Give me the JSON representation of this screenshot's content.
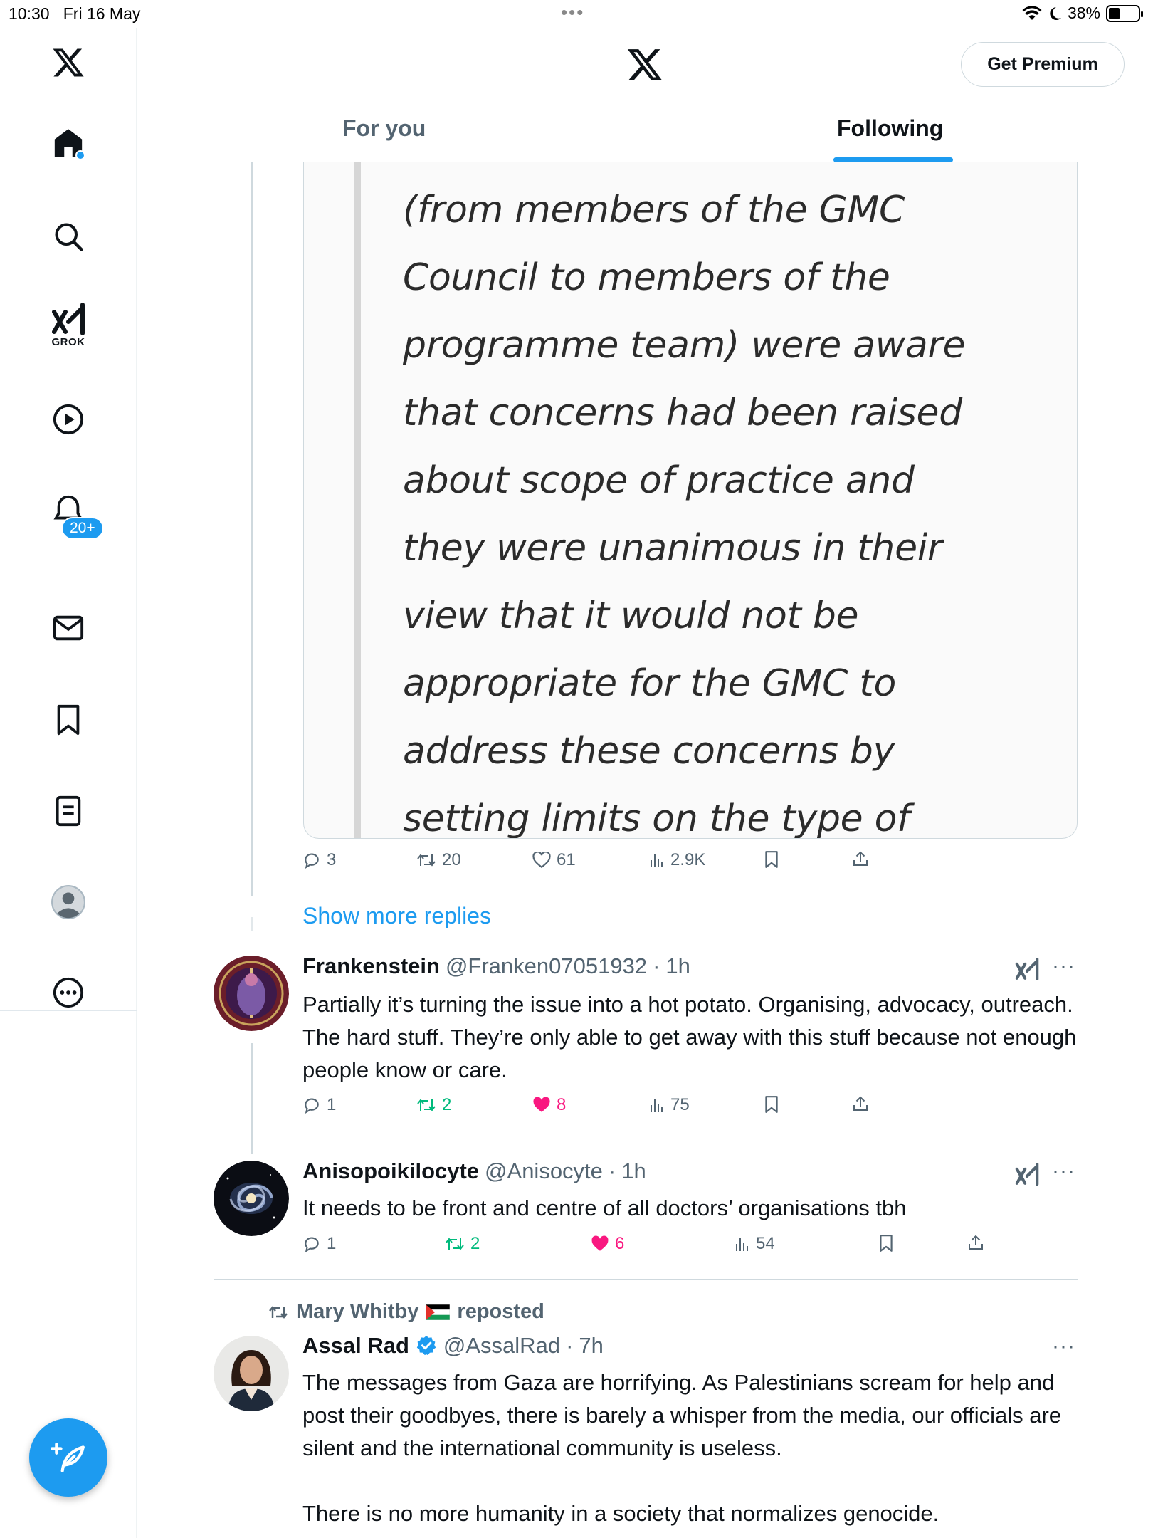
{
  "status_bar": {
    "time": "10:30",
    "date": "Fri 16 May",
    "battery": "38%"
  },
  "sidebar": {
    "items": [
      {
        "name": "x-logo"
      },
      {
        "name": "home"
      },
      {
        "name": "search"
      },
      {
        "name": "grok",
        "label": "GROK"
      },
      {
        "name": "videos"
      },
      {
        "name": "notifications",
        "badge": "20+"
      },
      {
        "name": "messages"
      },
      {
        "name": "bookmarks"
      },
      {
        "name": "lists"
      },
      {
        "name": "profile"
      },
      {
        "name": "more"
      }
    ],
    "compose_icon": "compose-feather-icon"
  },
  "header": {
    "premium_label": "Get Premium",
    "tabs": [
      {
        "label": "For you"
      },
      {
        "label": "Following"
      }
    ],
    "active_tab": "Following"
  },
  "quoted_image": {
    "lines": [
      "(from members of the GMC",
      "Council to members of the",
      "programme team) were aware",
      "that concerns had been raised",
      "about scope of practice and",
      "they were unanimous in their",
      "view that it would not be",
      "appropriate for the GMC to",
      "address these concerns by",
      "setting limits on the type of"
    ]
  },
  "first_tweet_actions": {
    "replies": "3",
    "reposts": "20",
    "likes": "61",
    "views": "2.9K"
  },
  "show_more_label": "Show more replies",
  "tweets": [
    {
      "name": "Frankenstein",
      "handle": "@Franken07051932",
      "time": "1h",
      "text": "Partially it’s turning the issue into a hot potato. Organising, advocacy, outreach. The hard stuff. They’re only able to get away with this stuff because not enough people know or care.",
      "replies": "1",
      "reposts": "2",
      "likes": "8",
      "views": "75"
    },
    {
      "name": "Anisopoikilocyte",
      "handle": "@Anisocyte",
      "time": "1h",
      "text": "It needs to be front and centre of all doctors’ organisations tbh",
      "replies": "1",
      "reposts": "2",
      "likes": "6",
      "views": "54"
    },
    {
      "reposted_by": "Mary Whitby",
      "reposted_label": "reposted",
      "name": "Assal Rad",
      "handle": "@AssalRad",
      "time": "7h",
      "text_p1": "The messages from Gaza are horrifying. As Palestinians scream for help and post their goodbyes, there is barely a whisper from the media, our officials are silent and the international community is useless.",
      "text_p2": "There is no more humanity in a society that normalizes genocide."
    }
  ],
  "colors": {
    "accent": "#1d9bf0",
    "repost": "#00ba7c",
    "like": "#f91880",
    "muted": "#536471"
  }
}
